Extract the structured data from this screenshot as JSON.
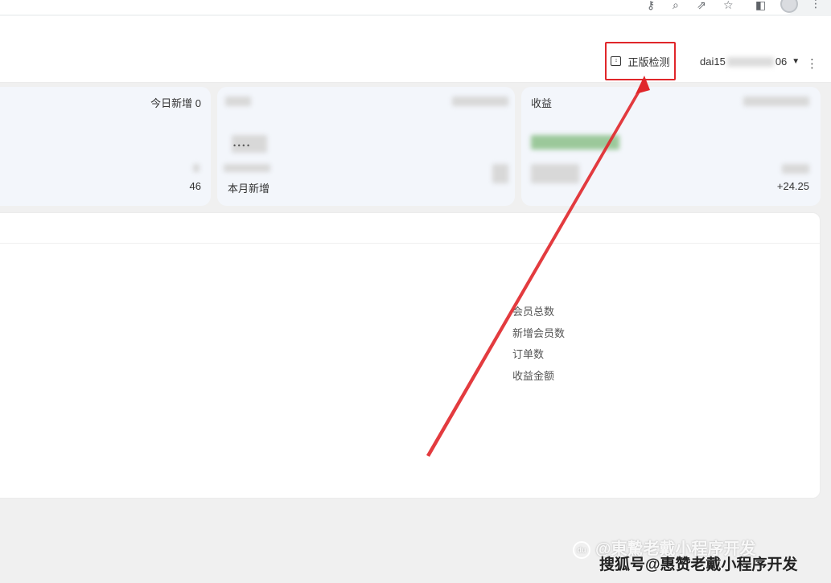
{
  "browser": {
    "icons": [
      "key-icon",
      "zoom-icon",
      "share-icon",
      "star-icon",
      "sidebar-icon",
      "profile-avatar",
      "kebab-icon"
    ]
  },
  "header": {
    "license_check_label": "正版检测",
    "username_prefix": "dai15",
    "username_suffix": "06",
    "more_glyph": "⋮"
  },
  "cards": {
    "card1": {
      "today_new": "今日新增 0",
      "value": "46"
    },
    "card2": {
      "month_new_label": "本月新增",
      "dots": "• • • •"
    },
    "card3": {
      "title": "收益",
      "delta": "+24.25"
    }
  },
  "chart": {
    "legend": [
      "会员总数",
      "新增会员数",
      "订单数",
      "收益金额"
    ]
  },
  "watermark": {
    "line1": "@東驇老戴小程序开发",
    "line2": "搜狐号@惠赞老戴小程序开发",
    "logo": "du"
  },
  "colors": {
    "highlight": "#e0262a",
    "card_bg": "#f3f6fb"
  }
}
